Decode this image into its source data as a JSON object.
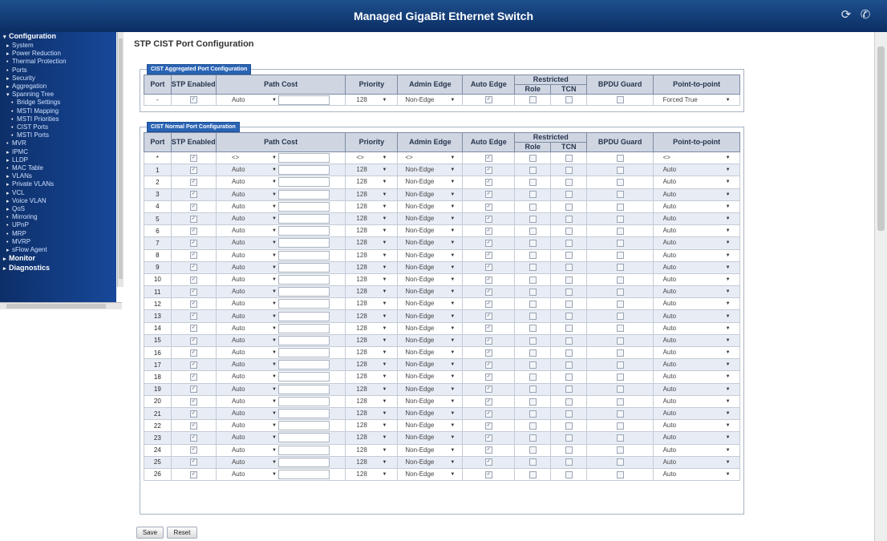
{
  "header": {
    "title": "Managed GigaBit Ethernet Switch",
    "icons": [
      "logout-icon",
      "help-icon"
    ]
  },
  "sidebar": {
    "items": [
      {
        "label": "Configuration",
        "level": 0,
        "marker": "▾"
      },
      {
        "label": "System",
        "level": 1,
        "marker": "▸"
      },
      {
        "label": "Power Reduction",
        "level": 1,
        "marker": "▸"
      },
      {
        "label": "Thermal Protection",
        "level": 1,
        "marker": "•"
      },
      {
        "label": "Ports",
        "level": 1,
        "marker": "•"
      },
      {
        "label": "Security",
        "level": 1,
        "marker": "▸"
      },
      {
        "label": "Aggregation",
        "level": 1,
        "marker": "▸"
      },
      {
        "label": "Spanning Tree",
        "level": 1,
        "marker": "▾"
      },
      {
        "label": "Bridge Settings",
        "level": 2,
        "marker": "•"
      },
      {
        "label": "MSTI Mapping",
        "level": 2,
        "marker": "•"
      },
      {
        "label": "MSTI Priorities",
        "level": 2,
        "marker": "•"
      },
      {
        "label": "CIST Ports",
        "level": 2,
        "marker": "•"
      },
      {
        "label": "MSTI Ports",
        "level": 2,
        "marker": "•"
      },
      {
        "label": "MVR",
        "level": 1,
        "marker": "•"
      },
      {
        "label": "IPMC",
        "level": 1,
        "marker": "▸"
      },
      {
        "label": "LLDP",
        "level": 1,
        "marker": "▸"
      },
      {
        "label": "MAC Table",
        "level": 1,
        "marker": "•"
      },
      {
        "label": "VLANs",
        "level": 1,
        "marker": "▸"
      },
      {
        "label": "Private VLANs",
        "level": 1,
        "marker": "▸"
      },
      {
        "label": "VCL",
        "level": 1,
        "marker": "▸"
      },
      {
        "label": "Voice VLAN",
        "level": 1,
        "marker": "▸"
      },
      {
        "label": "QoS",
        "level": 1,
        "marker": "▸"
      },
      {
        "label": "Mirroring",
        "level": 1,
        "marker": "•"
      },
      {
        "label": "UPnP",
        "level": 1,
        "marker": "•"
      },
      {
        "label": "MRP",
        "level": 1,
        "marker": "•"
      },
      {
        "label": "MVRP",
        "level": 1,
        "marker": "•"
      },
      {
        "label": "sFlow Agent",
        "level": 1,
        "marker": "▸"
      },
      {
        "label": "Monitor",
        "level": 0,
        "marker": "▸"
      },
      {
        "label": "Diagnostics",
        "level": 0,
        "marker": "▸"
      }
    ]
  },
  "page": {
    "title": "STP CIST Port Configuration"
  },
  "headers": {
    "port": "Port",
    "stp_enabled": "STP Enabled",
    "path_cost": "Path Cost",
    "priority": "Priority",
    "admin_edge": "Admin Edge",
    "auto_edge": "Auto Edge",
    "restricted": "Restricted",
    "role": "Role",
    "tcn": "TCN",
    "bpdu_guard": "BPDU Guard",
    "p2p": "Point-to-point"
  },
  "aggregated": {
    "legend": "CIST Aggregated Port Configuration",
    "row": {
      "port": "-",
      "path_cost": "Auto",
      "priority": "128",
      "admin_edge": "Non-Edge",
      "p2p": "Forced True"
    }
  },
  "normal": {
    "legend": "CIST Normal Port Configuration",
    "wildcard": {
      "port": "*",
      "path_cost": "<>",
      "priority": "<>",
      "admin_edge": "<>",
      "p2p": "<>"
    },
    "rows": [
      {
        "port": "1",
        "path_cost": "Auto",
        "priority": "128",
        "admin_edge": "Non-Edge",
        "p2p": "Auto"
      },
      {
        "port": "2",
        "path_cost": "Auto",
        "priority": "128",
        "admin_edge": "Non-Edge",
        "p2p": "Auto"
      },
      {
        "port": "3",
        "path_cost": "Auto",
        "priority": "128",
        "admin_edge": "Non-Edge",
        "p2p": "Auto"
      },
      {
        "port": "4",
        "path_cost": "Auto",
        "priority": "128",
        "admin_edge": "Non-Edge",
        "p2p": "Auto"
      },
      {
        "port": "5",
        "path_cost": "Auto",
        "priority": "128",
        "admin_edge": "Non-Edge",
        "p2p": "Auto"
      },
      {
        "port": "6",
        "path_cost": "Auto",
        "priority": "128",
        "admin_edge": "Non-Edge",
        "p2p": "Auto"
      },
      {
        "port": "7",
        "path_cost": "Auto",
        "priority": "128",
        "admin_edge": "Non-Edge",
        "p2p": "Auto"
      },
      {
        "port": "8",
        "path_cost": "Auto",
        "priority": "128",
        "admin_edge": "Non-Edge",
        "p2p": "Auto"
      },
      {
        "port": "9",
        "path_cost": "Auto",
        "priority": "128",
        "admin_edge": "Non-Edge",
        "p2p": "Auto"
      },
      {
        "port": "10",
        "path_cost": "Auto",
        "priority": "128",
        "admin_edge": "Non-Edge",
        "p2p": "Auto"
      },
      {
        "port": "11",
        "path_cost": "Auto",
        "priority": "128",
        "admin_edge": "Non-Edge",
        "p2p": "Auto"
      },
      {
        "port": "12",
        "path_cost": "Auto",
        "priority": "128",
        "admin_edge": "Non-Edge",
        "p2p": "Auto"
      },
      {
        "port": "13",
        "path_cost": "Auto",
        "priority": "128",
        "admin_edge": "Non-Edge",
        "p2p": "Auto"
      },
      {
        "port": "14",
        "path_cost": "Auto",
        "priority": "128",
        "admin_edge": "Non-Edge",
        "p2p": "Auto"
      },
      {
        "port": "15",
        "path_cost": "Auto",
        "priority": "128",
        "admin_edge": "Non-Edge",
        "p2p": "Auto"
      },
      {
        "port": "16",
        "path_cost": "Auto",
        "priority": "128",
        "admin_edge": "Non-Edge",
        "p2p": "Auto"
      },
      {
        "port": "17",
        "path_cost": "Auto",
        "priority": "128",
        "admin_edge": "Non-Edge",
        "p2p": "Auto"
      },
      {
        "port": "18",
        "path_cost": "Auto",
        "priority": "128",
        "admin_edge": "Non-Edge",
        "p2p": "Auto"
      },
      {
        "port": "19",
        "path_cost": "Auto",
        "priority": "128",
        "admin_edge": "Non-Edge",
        "p2p": "Auto"
      },
      {
        "port": "20",
        "path_cost": "Auto",
        "priority": "128",
        "admin_edge": "Non-Edge",
        "p2p": "Auto"
      },
      {
        "port": "21",
        "path_cost": "Auto",
        "priority": "128",
        "admin_edge": "Non-Edge",
        "p2p": "Auto"
      },
      {
        "port": "22",
        "path_cost": "Auto",
        "priority": "128",
        "admin_edge": "Non-Edge",
        "p2p": "Auto"
      },
      {
        "port": "23",
        "path_cost": "Auto",
        "priority": "128",
        "admin_edge": "Non-Edge",
        "p2p": "Auto"
      },
      {
        "port": "24",
        "path_cost": "Auto",
        "priority": "128",
        "admin_edge": "Non-Edge",
        "p2p": "Auto"
      },
      {
        "port": "25",
        "path_cost": "Auto",
        "priority": "128",
        "admin_edge": "Non-Edge",
        "p2p": "Auto"
      },
      {
        "port": "26",
        "path_cost": "Auto",
        "priority": "128",
        "admin_edge": "Non-Edge",
        "p2p": "Auto"
      }
    ]
  },
  "buttons": {
    "save": "Save",
    "reset": "Reset"
  },
  "colors": {
    "header": "#0b2e63",
    "sidebar": "#17489a",
    "legend": "#2a64b4",
    "table_header": "#cfd6e2"
  }
}
